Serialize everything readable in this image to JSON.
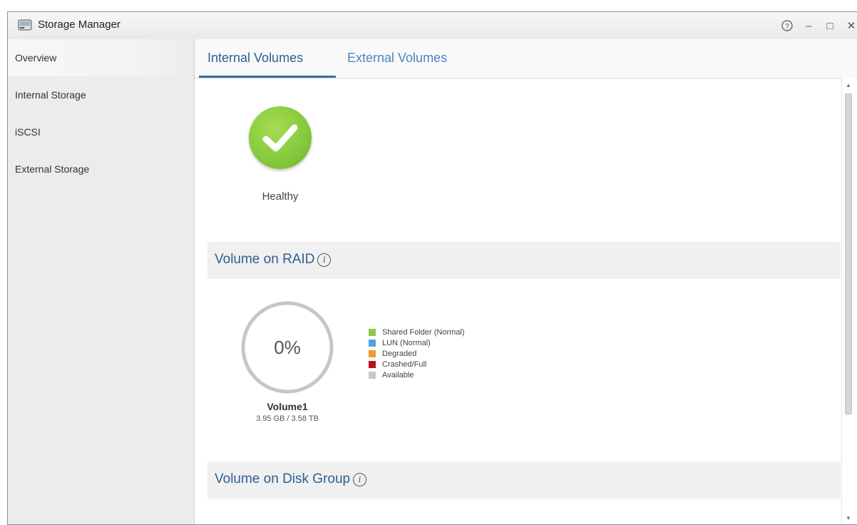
{
  "window": {
    "title": "Storage Manager",
    "controls": {
      "help": "?",
      "minimize": "–",
      "maximize": "□",
      "close": "✕"
    }
  },
  "sidebar": {
    "items": [
      {
        "label": "Overview",
        "active": true
      },
      {
        "label": "Internal Storage",
        "active": false
      },
      {
        "label": "iSCSI",
        "active": false
      },
      {
        "label": "External Storage",
        "active": false
      }
    ]
  },
  "tabs": [
    {
      "label": "Internal Volumes",
      "active": true
    },
    {
      "label": "External Volumes",
      "active": false
    }
  ],
  "health": {
    "status": "Healthy",
    "icon": "checkmark-icon",
    "color": "#84c93b"
  },
  "raid_section": {
    "title": "Volume on RAID",
    "volume": {
      "percent": "0%",
      "name": "Volume1",
      "size": "3.95 GB / 3.58 TB",
      "used_fraction": 0.0
    }
  },
  "legend": [
    {
      "label": "Shared Folder (Normal)",
      "color": "#8cc84b"
    },
    {
      "label": "LUN (Normal)",
      "color": "#4fa3e0"
    },
    {
      "label": "Degraded",
      "color": "#f29a2e"
    },
    {
      "label": "Crashed/Full",
      "color": "#b5121b"
    },
    {
      "label": "Available",
      "color": "#c8c8c8"
    }
  ],
  "disk_group_section": {
    "title": "Volume on Disk Group"
  }
}
